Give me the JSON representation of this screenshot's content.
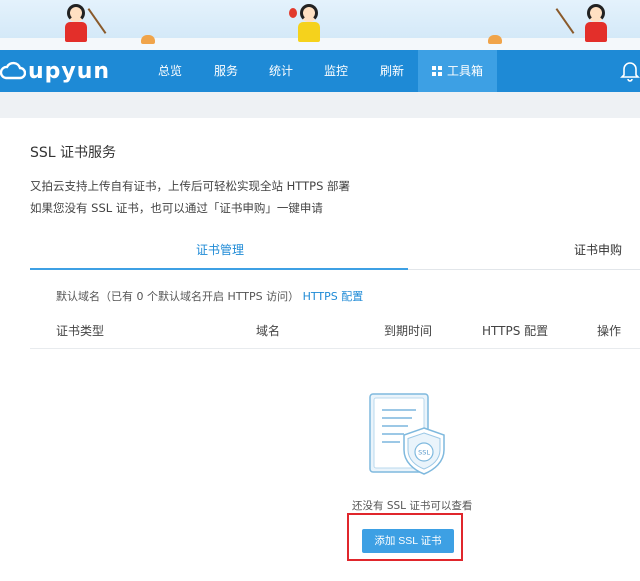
{
  "navbar": {
    "logo_text": "upyun",
    "items": [
      {
        "label": "总览"
      },
      {
        "label": "服务"
      },
      {
        "label": "统计"
      },
      {
        "label": "监控"
      },
      {
        "label": "刷新"
      },
      {
        "label": "工具箱"
      }
    ],
    "active_index": 5
  },
  "page": {
    "title": "SSL 证书服务",
    "description_line1": "又拍云支持上传自有证书，上传后可轻松实现全站 HTTPS 部署",
    "description_line2": "如果您没有 SSL 证书，也可以通过「证书申购」一键申请"
  },
  "tabs": [
    {
      "label": "证书管理",
      "active": true
    },
    {
      "label": "证书申购",
      "active": false
    }
  ],
  "default_domain": {
    "text": "默认域名（已有 0 个默认域名开启 HTTPS 访问）",
    "link": "HTTPS 配置"
  },
  "table": {
    "headers": [
      "证书类型",
      "域名",
      "到期时间",
      "HTTPS 配置",
      "操作"
    ]
  },
  "empty_state": {
    "badge": "SSL",
    "message": "还没有 SSL 证书可以查看",
    "button_label": "添加 SSL 证书"
  },
  "colors": {
    "brand_blue": "#1e8ad6",
    "active_nav": "#3da0e4",
    "highlight_red": "#e0262c"
  }
}
